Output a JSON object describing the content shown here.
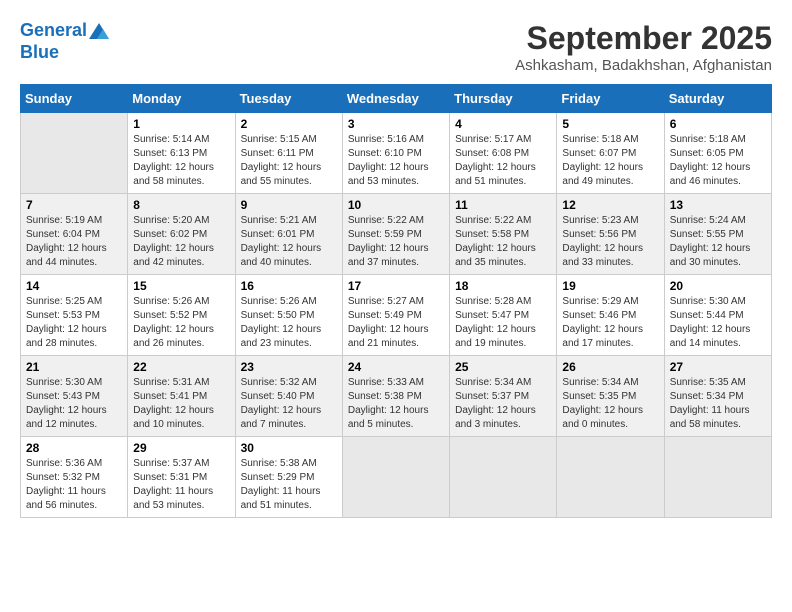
{
  "header": {
    "logo_line1": "General",
    "logo_line2": "Blue",
    "month": "September 2025",
    "location": "Ashkasham, Badakhshan, Afghanistan"
  },
  "days_of_week": [
    "Sunday",
    "Monday",
    "Tuesday",
    "Wednesday",
    "Thursday",
    "Friday",
    "Saturday"
  ],
  "weeks": [
    [
      {
        "num": "",
        "info": ""
      },
      {
        "num": "1",
        "info": "Sunrise: 5:14 AM\nSunset: 6:13 PM\nDaylight: 12 hours\nand 58 minutes."
      },
      {
        "num": "2",
        "info": "Sunrise: 5:15 AM\nSunset: 6:11 PM\nDaylight: 12 hours\nand 55 minutes."
      },
      {
        "num": "3",
        "info": "Sunrise: 5:16 AM\nSunset: 6:10 PM\nDaylight: 12 hours\nand 53 minutes."
      },
      {
        "num": "4",
        "info": "Sunrise: 5:17 AM\nSunset: 6:08 PM\nDaylight: 12 hours\nand 51 minutes."
      },
      {
        "num": "5",
        "info": "Sunrise: 5:18 AM\nSunset: 6:07 PM\nDaylight: 12 hours\nand 49 minutes."
      },
      {
        "num": "6",
        "info": "Sunrise: 5:18 AM\nSunset: 6:05 PM\nDaylight: 12 hours\nand 46 minutes."
      }
    ],
    [
      {
        "num": "7",
        "info": "Sunrise: 5:19 AM\nSunset: 6:04 PM\nDaylight: 12 hours\nand 44 minutes."
      },
      {
        "num": "8",
        "info": "Sunrise: 5:20 AM\nSunset: 6:02 PM\nDaylight: 12 hours\nand 42 minutes."
      },
      {
        "num": "9",
        "info": "Sunrise: 5:21 AM\nSunset: 6:01 PM\nDaylight: 12 hours\nand 40 minutes."
      },
      {
        "num": "10",
        "info": "Sunrise: 5:22 AM\nSunset: 5:59 PM\nDaylight: 12 hours\nand 37 minutes."
      },
      {
        "num": "11",
        "info": "Sunrise: 5:22 AM\nSunset: 5:58 PM\nDaylight: 12 hours\nand 35 minutes."
      },
      {
        "num": "12",
        "info": "Sunrise: 5:23 AM\nSunset: 5:56 PM\nDaylight: 12 hours\nand 33 minutes."
      },
      {
        "num": "13",
        "info": "Sunrise: 5:24 AM\nSunset: 5:55 PM\nDaylight: 12 hours\nand 30 minutes."
      }
    ],
    [
      {
        "num": "14",
        "info": "Sunrise: 5:25 AM\nSunset: 5:53 PM\nDaylight: 12 hours\nand 28 minutes."
      },
      {
        "num": "15",
        "info": "Sunrise: 5:26 AM\nSunset: 5:52 PM\nDaylight: 12 hours\nand 26 minutes."
      },
      {
        "num": "16",
        "info": "Sunrise: 5:26 AM\nSunset: 5:50 PM\nDaylight: 12 hours\nand 23 minutes."
      },
      {
        "num": "17",
        "info": "Sunrise: 5:27 AM\nSunset: 5:49 PM\nDaylight: 12 hours\nand 21 minutes."
      },
      {
        "num": "18",
        "info": "Sunrise: 5:28 AM\nSunset: 5:47 PM\nDaylight: 12 hours\nand 19 minutes."
      },
      {
        "num": "19",
        "info": "Sunrise: 5:29 AM\nSunset: 5:46 PM\nDaylight: 12 hours\nand 17 minutes."
      },
      {
        "num": "20",
        "info": "Sunrise: 5:30 AM\nSunset: 5:44 PM\nDaylight: 12 hours\nand 14 minutes."
      }
    ],
    [
      {
        "num": "21",
        "info": "Sunrise: 5:30 AM\nSunset: 5:43 PM\nDaylight: 12 hours\nand 12 minutes."
      },
      {
        "num": "22",
        "info": "Sunrise: 5:31 AM\nSunset: 5:41 PM\nDaylight: 12 hours\nand 10 minutes."
      },
      {
        "num": "23",
        "info": "Sunrise: 5:32 AM\nSunset: 5:40 PM\nDaylight: 12 hours\nand 7 minutes."
      },
      {
        "num": "24",
        "info": "Sunrise: 5:33 AM\nSunset: 5:38 PM\nDaylight: 12 hours\nand 5 minutes."
      },
      {
        "num": "25",
        "info": "Sunrise: 5:34 AM\nSunset: 5:37 PM\nDaylight: 12 hours\nand 3 minutes."
      },
      {
        "num": "26",
        "info": "Sunrise: 5:34 AM\nSunset: 5:35 PM\nDaylight: 12 hours\nand 0 minutes."
      },
      {
        "num": "27",
        "info": "Sunrise: 5:35 AM\nSunset: 5:34 PM\nDaylight: 11 hours\nand 58 minutes."
      }
    ],
    [
      {
        "num": "28",
        "info": "Sunrise: 5:36 AM\nSunset: 5:32 PM\nDaylight: 11 hours\nand 56 minutes."
      },
      {
        "num": "29",
        "info": "Sunrise: 5:37 AM\nSunset: 5:31 PM\nDaylight: 11 hours\nand 53 minutes."
      },
      {
        "num": "30",
        "info": "Sunrise: 5:38 AM\nSunset: 5:29 PM\nDaylight: 11 hours\nand 51 minutes."
      },
      {
        "num": "",
        "info": ""
      },
      {
        "num": "",
        "info": ""
      },
      {
        "num": "",
        "info": ""
      },
      {
        "num": "",
        "info": ""
      }
    ]
  ]
}
